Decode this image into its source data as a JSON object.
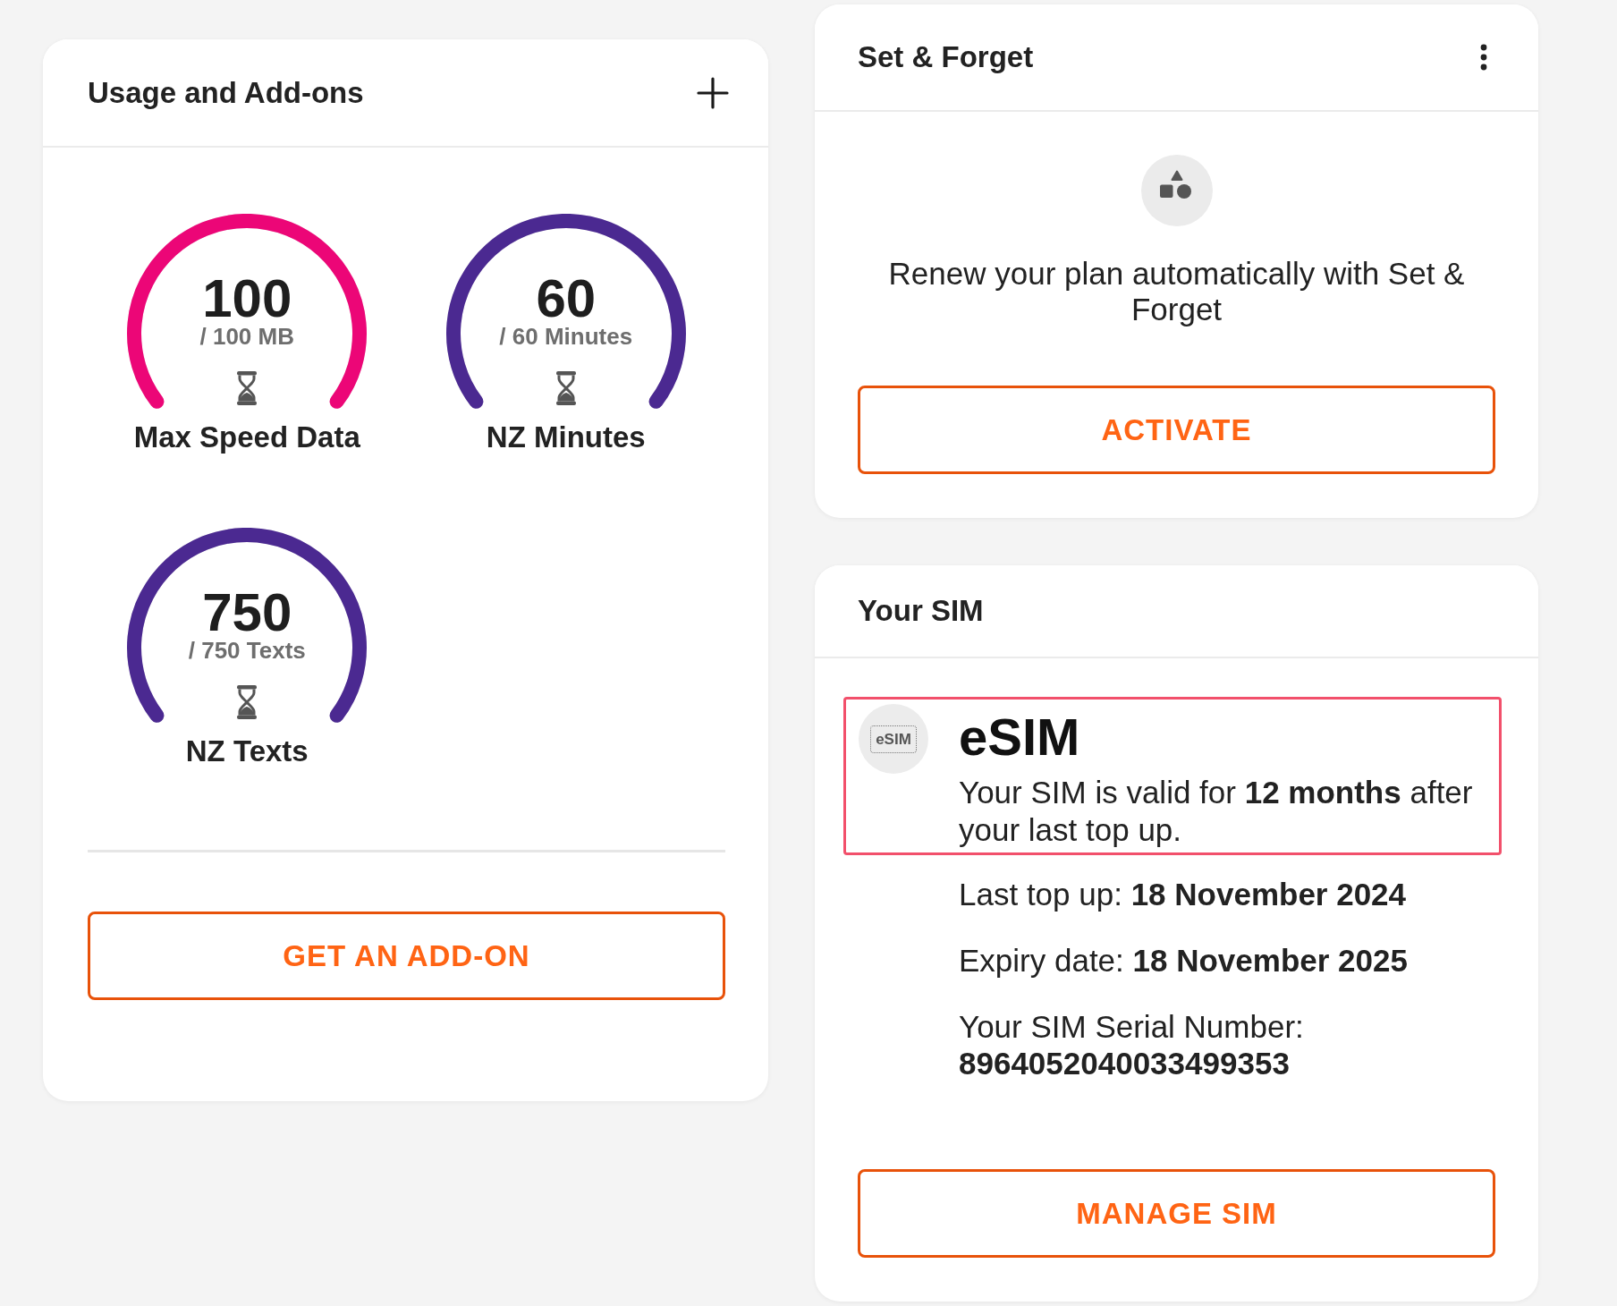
{
  "usage_card": {
    "title": "Usage and Add-ons",
    "gauges": [
      {
        "value": "100",
        "allowance": "/ 100 MB",
        "label": "Max Speed Data",
        "level": 1,
        "color": "#ec0677"
      },
      {
        "value": "60",
        "allowance": "/ 60 Minutes",
        "label": "NZ Minutes",
        "level": 1,
        "color": "#4b2991"
      },
      {
        "value": "750",
        "allowance": "/ 750 Texts",
        "label": "NZ Texts",
        "level": 1,
        "color": "#4b2991"
      }
    ],
    "button": "GET AN ADD-ON"
  },
  "set_and_forget_card": {
    "title": "Set & Forget",
    "message": "Renew your plan automatically with Set & Forget",
    "button": "ACTIVATE"
  },
  "sim_card": {
    "title": "Your SIM",
    "sim": {
      "icon_label": "eSIM",
      "type": "eSIM",
      "description": "Your SIM is valid for **12 months** after your last top up.",
      "highlighted": true
    },
    "details": [
      "Last top up: **18 November 2024**",
      "Expiry date: **18 November 2025**",
      "Your SIM Serial Number: **8964052040033499353**"
    ],
    "button": "MANAGE SIM"
  }
}
